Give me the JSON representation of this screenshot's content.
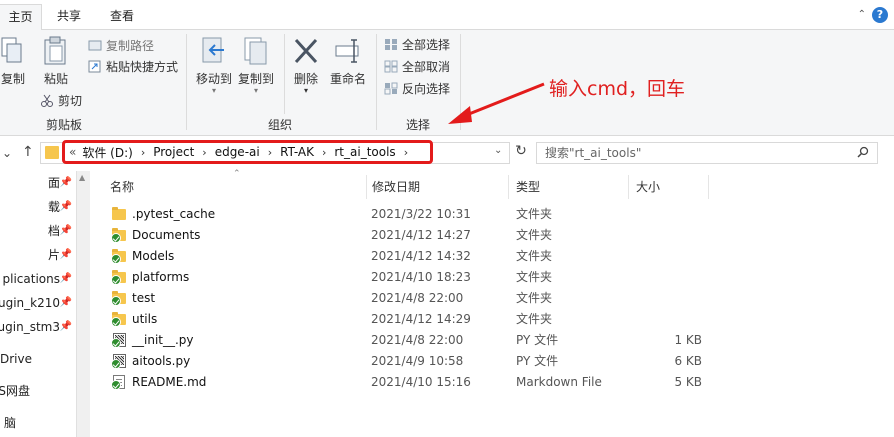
{
  "tabs": [
    {
      "label": "主页"
    },
    {
      "label": "共享"
    },
    {
      "label": "查看"
    }
  ],
  "ribbon": {
    "clipboard": {
      "copy": "复制",
      "paste": "粘贴",
      "copy_path": "复制路径",
      "paste_shortcut": "粘贴快捷方式",
      "cut": "剪切",
      "label": "剪贴板"
    },
    "organize": {
      "move_to": "移动到",
      "copy_to": "复制到",
      "delete": "删除",
      "rename": "重命名",
      "label": "组织"
    },
    "select": {
      "select_all": "全部选择",
      "select_none": "全部取消",
      "invert": "反向选择",
      "label": "选择"
    }
  },
  "annotation": {
    "text": "输入cmd，回车",
    "color": "#e02020"
  },
  "address": {
    "prefix": "«",
    "crumbs": [
      "软件 (D:)",
      "Project",
      "edge-ai",
      "RT-AK",
      "rt_ai_tools"
    ],
    "highlight_color": "#e31b1b"
  },
  "search": {
    "placeholder": "搜索\"rt_ai_tools\""
  },
  "nav": {
    "items": [
      {
        "label": "面",
        "pinned": true
      },
      {
        "label": "载",
        "pinned": true
      },
      {
        "label": "档",
        "pinned": true
      },
      {
        "label": "片",
        "pinned": true
      },
      {
        "label": "plications",
        "pinned": true
      },
      {
        "label": "ugin_k210",
        "pinned": true
      },
      {
        "label": "ugin_stm3",
        "pinned": true
      },
      {
        "label": "eDrive",
        "pinned": false
      },
      {
        "label": "S网盘",
        "pinned": false
      },
      {
        "label": "脑",
        "pinned": false
      }
    ]
  },
  "columns": {
    "name": "名称",
    "date": "修改日期",
    "type": "类型",
    "size": "大小"
  },
  "files": [
    {
      "name": ".pytest_cache",
      "date": "2021/3/22 10:31",
      "type": "文件夹",
      "size": "",
      "icon": "folder",
      "synced": false
    },
    {
      "name": "Documents",
      "date": "2021/4/12 14:27",
      "type": "文件夹",
      "size": "",
      "icon": "folder",
      "synced": true
    },
    {
      "name": "Models",
      "date": "2021/4/12 14:32",
      "type": "文件夹",
      "size": "",
      "icon": "folder",
      "synced": true
    },
    {
      "name": "platforms",
      "date": "2021/4/10 18:23",
      "type": "文件夹",
      "size": "",
      "icon": "folder",
      "synced": true
    },
    {
      "name": "test",
      "date": "2021/4/8 22:00",
      "type": "文件夹",
      "size": "",
      "icon": "folder",
      "synced": true
    },
    {
      "name": "utils",
      "date": "2021/4/12 14:29",
      "type": "文件夹",
      "size": "",
      "icon": "folder",
      "synced": true
    },
    {
      "name": "__init__.py",
      "date": "2021/4/8 22:00",
      "type": "PY 文件",
      "size": "1 KB",
      "icon": "py",
      "synced": true
    },
    {
      "name": "aitools.py",
      "date": "2021/4/9 10:58",
      "type": "PY 文件",
      "size": "6 KB",
      "icon": "py",
      "synced": true
    },
    {
      "name": "README.md",
      "date": "2021/4/10 15:16",
      "type": "Markdown File",
      "size": "5 KB",
      "icon": "doc",
      "synced": true
    }
  ]
}
